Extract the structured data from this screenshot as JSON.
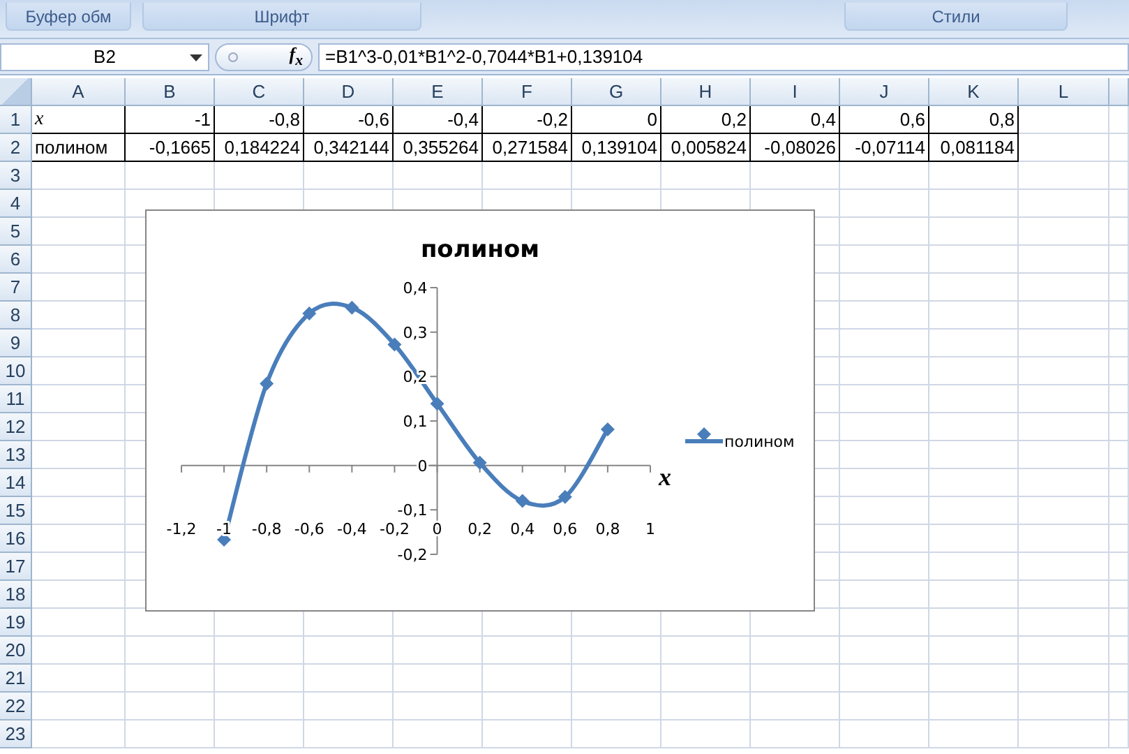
{
  "ribbon": {
    "groups": [
      "Буфер обм",
      "Шрифт",
      "Стили"
    ]
  },
  "formula_bar": {
    "name_box": "B2",
    "fx_label": "f$_{x}$",
    "formula": "=B1^3-0,01*B1^2-0,7044*B1+0,139104"
  },
  "sheet": {
    "columns": [
      "A",
      "B",
      "C",
      "D",
      "E",
      "F",
      "G",
      "H",
      "I",
      "J",
      "K",
      "L"
    ],
    "rows": [
      "1",
      "2",
      "3",
      "4",
      "5",
      "6",
      "7",
      "8",
      "9",
      "10",
      "11",
      "12",
      "13",
      "14",
      "15",
      "16",
      "17",
      "18",
      "19",
      "20",
      "21",
      "22",
      "23"
    ],
    "cells": [
      [
        "x",
        "-1",
        "-0,8",
        "-0,6",
        "-0,4",
        "-0,2",
        "0",
        "0,2",
        "0,4",
        "0,6",
        "0,8"
      ],
      [
        "полином",
        "-0,1665",
        "0,184224",
        "0,342144",
        "0,355264",
        "0,271584",
        "0,139104",
        "0,005824",
        "-0,08026",
        "-0,07114",
        "0,081184"
      ]
    ]
  },
  "chart": {
    "chart_data": {
      "type": "line",
      "title": "полином",
      "xlabel": "x",
      "x": [
        -1,
        -0.8,
        -0.6,
        -0.4,
        -0.2,
        0,
        0.2,
        0.4,
        0.6,
        0.8
      ],
      "series": [
        {
          "name": "полином",
          "color": "#4a7ebb",
          "marker": "diamond",
          "values": [
            -0.167,
            0.184,
            0.342,
            0.355,
            0.272,
            0.139,
            0.006,
            -0.08,
            -0.071,
            0.081
          ]
        }
      ],
      "xlim": [
        -1.2,
        1
      ],
      "ylim": [
        -0.2,
        0.4
      ],
      "xticks": [
        {
          "value": -1.2,
          "label": "-1,2"
        },
        {
          "value": -1,
          "label": "-1"
        },
        {
          "value": -0.8,
          "label": "-0,8"
        },
        {
          "value": -0.6,
          "label": "-0,6"
        },
        {
          "value": -0.4,
          "label": "-0,4"
        },
        {
          "value": -0.2,
          "label": "-0,2"
        },
        {
          "value": 0,
          "label": "0"
        },
        {
          "value": 0.2,
          "label": "0,2"
        },
        {
          "value": 0.4,
          "label": "0,4"
        },
        {
          "value": 0.6,
          "label": "0,6"
        },
        {
          "value": 0.8,
          "label": "0,8"
        },
        {
          "value": 1,
          "label": "1"
        }
      ],
      "yticks": [
        {
          "value": -0.2,
          "label": "-0,2"
        },
        {
          "value": -0.1,
          "label": "-0,1"
        },
        {
          "value": 0,
          "label": "0"
        },
        {
          "value": 0.1,
          "label": "0,1"
        },
        {
          "value": 0.2,
          "label": "0,2"
        },
        {
          "value": 0.3,
          "label": "0,3"
        },
        {
          "value": 0.4,
          "label": "0,4"
        }
      ]
    }
  }
}
